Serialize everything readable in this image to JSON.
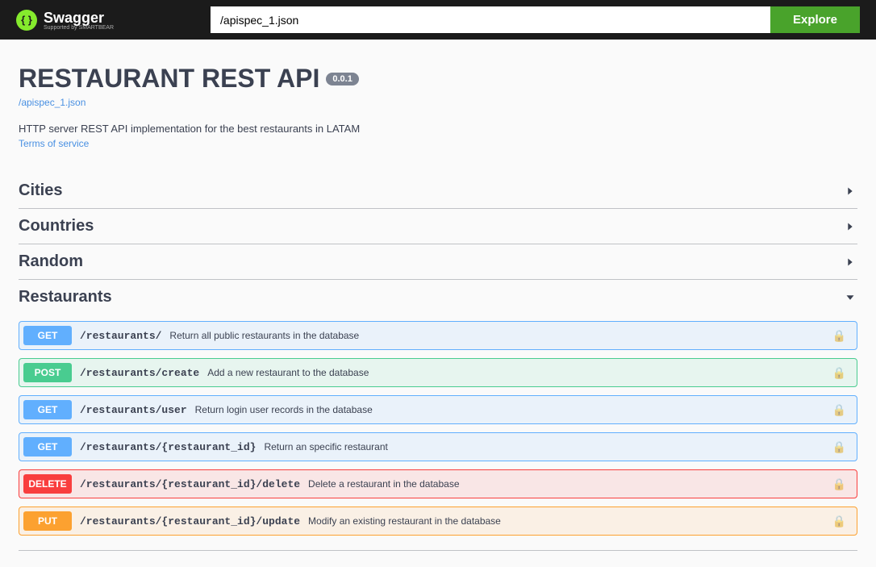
{
  "topbar": {
    "logo_text": "Swagger",
    "logo_sub": "Supported by SMARTBEAR",
    "spec_url": "/apispec_1.json",
    "explore": "Explore"
  },
  "info": {
    "title": "RESTAURANT REST API",
    "version": "0.0.1",
    "spec_link": "/apispec_1.json",
    "description": "HTTP server REST API implementation for the best restaurants in LATAM",
    "tos": "Terms of service"
  },
  "tags": [
    {
      "name": "Cities",
      "expanded": false,
      "ops": []
    },
    {
      "name": "Countries",
      "expanded": false,
      "ops": []
    },
    {
      "name": "Random",
      "expanded": false,
      "ops": []
    },
    {
      "name": "Restaurants",
      "expanded": true,
      "ops": [
        {
          "method": "GET",
          "path": "/restaurants/",
          "summary": "Return all public restaurants in the database",
          "locked": true
        },
        {
          "method": "POST",
          "path": "/restaurants/create",
          "summary": "Add a new restaurant to the database",
          "locked": true
        },
        {
          "method": "GET",
          "path": "/restaurants/user",
          "summary": "Return login user records in the database",
          "locked": true
        },
        {
          "method": "GET",
          "path": "/restaurants/{restaurant_id}",
          "summary": "Return an specific restaurant",
          "locked": true
        },
        {
          "method": "DELETE",
          "path": "/restaurants/{restaurant_id}/delete",
          "summary": "Delete a restaurant in the database",
          "locked": true
        },
        {
          "method": "PUT",
          "path": "/restaurants/{restaurant_id}/update",
          "summary": "Modify an existing restaurant in the database",
          "locked": true
        }
      ]
    }
  ]
}
